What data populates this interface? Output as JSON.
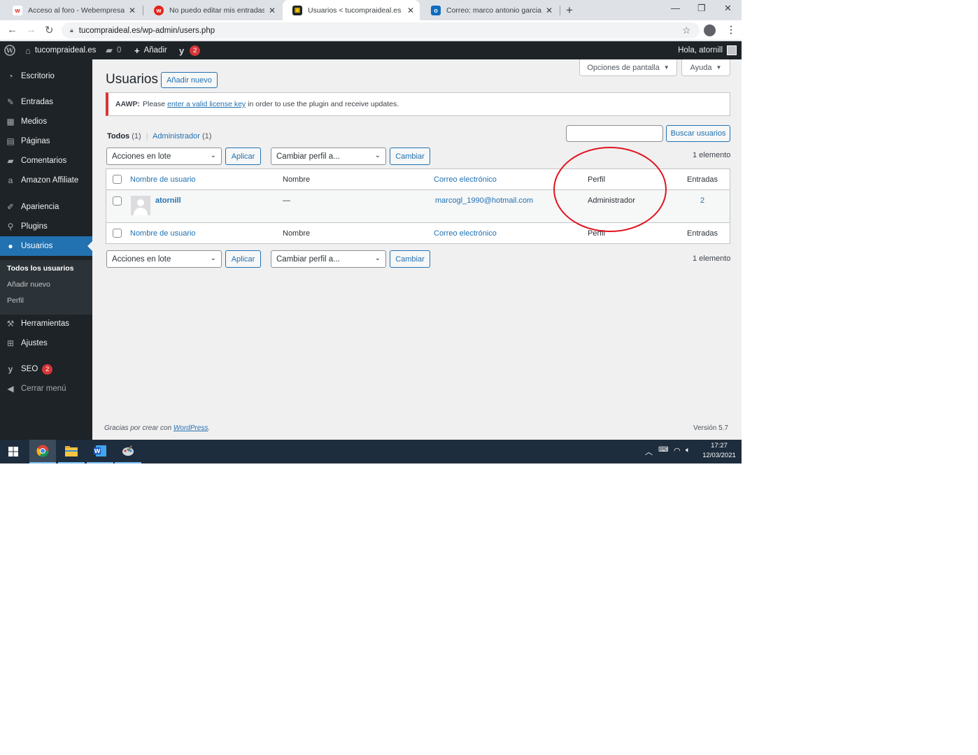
{
  "browser": {
    "tabs": [
      {
        "title": "Acceso al foro - Webempresa Eu",
        "favicon": "w",
        "favicon_color": "#ffffff",
        "favicon_fg": "#e2231a",
        "active": false
      },
      {
        "title": "No puedo editar mis entradas – ",
        "favicon": "w",
        "favicon_color": "#e2231a",
        "favicon_fg": "#ffffff",
        "active": false
      },
      {
        "title": "Usuarios < tucompraideal.es — ",
        "favicon": "▣",
        "favicon_color": "#1d2327",
        "favicon_fg": "#f0c400",
        "active": true
      },
      {
        "title": "Correo: marco antonio garcia leo",
        "favicon": "o",
        "favicon_color": "#0f6cbd",
        "favicon_fg": "#ffffff",
        "active": false
      }
    ],
    "url": "tucompraideal.es/wp-admin/users.php"
  },
  "adminbar": {
    "site_name": "tucompraideal.es",
    "comments_count": "0",
    "new_label": "Añadir",
    "yoast_badge": "2",
    "greeting": "Hola, atornill"
  },
  "sidebar": {
    "items": [
      {
        "label": "Escritorio",
        "icon": "dashboard-icon"
      },
      {
        "label": "Entradas",
        "icon": "pin-icon"
      },
      {
        "label": "Medios",
        "icon": "media-icon"
      },
      {
        "label": "Páginas",
        "icon": "page-icon"
      },
      {
        "label": "Comentarios",
        "icon": "comment-icon"
      },
      {
        "label": "Amazon Affiliate",
        "icon": "amazon-icon"
      },
      {
        "label": "Apariencia",
        "icon": "brush-icon"
      },
      {
        "label": "Plugins",
        "icon": "plugin-icon"
      },
      {
        "label": "Usuarios",
        "icon": "user-icon"
      },
      {
        "label": "Herramientas",
        "icon": "wrench-icon"
      },
      {
        "label": "Ajustes",
        "icon": "settings-icon"
      },
      {
        "label": "SEO",
        "icon": "yoast-icon",
        "badge": "2"
      },
      {
        "label": "Cerrar menú",
        "icon": "collapse-icon"
      }
    ],
    "submenu": [
      "Todos los usuarios",
      "Añadir nuevo",
      "Perfil"
    ]
  },
  "main": {
    "title": "Usuarios",
    "add_new": "Añadir nuevo",
    "screen_options": "Opciones de pantalla",
    "help": "Ayuda",
    "notice": {
      "label": "AAWP:",
      "before": "Please",
      "link": "enter a valid license key",
      "after": "in order to use the plugin and receive updates."
    },
    "views": {
      "all": "Todos",
      "all_count": "(1)",
      "admin": "Administrador",
      "admin_count": "(1)",
      "separator": "|"
    },
    "search_value": "",
    "search_button": "Buscar usuarios",
    "bulk_select": "Acciones en lote",
    "apply_button": "Aplicar",
    "role_select": "Cambiar perfil a...",
    "change_button": "Cambiar",
    "items_count": "1 elemento"
  },
  "table": {
    "columns": [
      "Nombre de usuario",
      "Nombre",
      "Correo electrónico",
      "Perfil",
      "Entradas"
    ],
    "rows": [
      {
        "username": "atornill",
        "name": "—",
        "email": "marcogl_1990@hotmail.com",
        "role": "Administrador",
        "posts": "2"
      }
    ]
  },
  "footer": {
    "thanks_before": "Gracias por crear con",
    "thanks_link": "WordPress",
    "thanks_after": ".",
    "version": "Versión 5.7"
  },
  "taskbar": {
    "time": "17:27",
    "date": "12/03/2021"
  },
  "colors": {
    "accent": "#2271b1",
    "annotation": "#e0141e",
    "admin_dark": "#1d2327"
  }
}
